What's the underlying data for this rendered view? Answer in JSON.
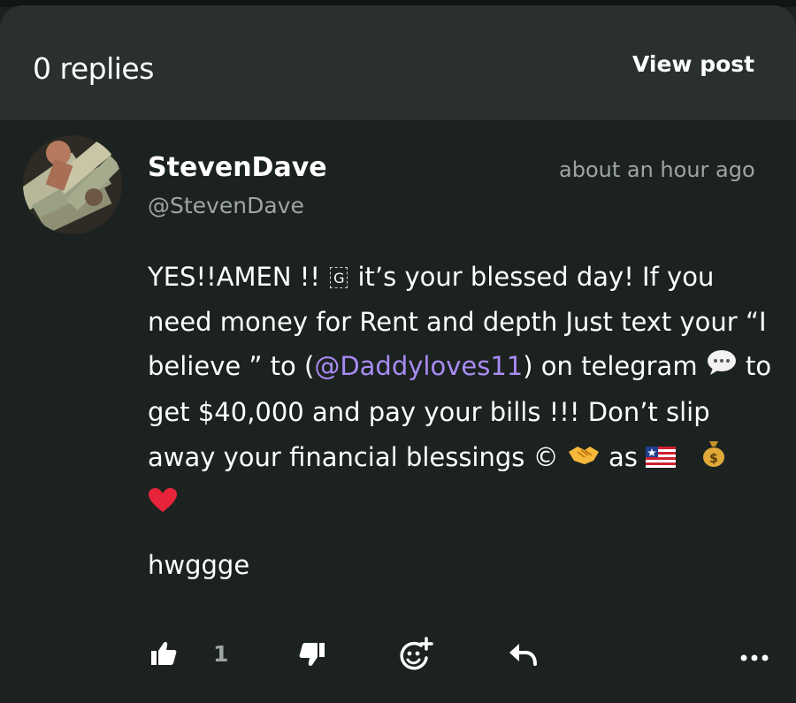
{
  "header": {
    "replies_label": "0 replies",
    "view_post_label": "View post"
  },
  "post": {
    "author_name": "StevenDave",
    "author_handle": "@StevenDave",
    "timestamp": "about an hour ago",
    "body": {
      "part1": "YES!!AMEN !! ",
      "glyph_box": "G",
      "part2": " it’s your blessed day! If you need money for Rent and depth  Just text your “I believe ” to (",
      "mention": "@Daddyloves11",
      "part3": ") on telegram ",
      "part4": "  to get $40,000 and pay your bills !!! Don’t slip away your financial blessings © ",
      "part5": "  as "
    },
    "extra_text": "hwggge",
    "like_count": "1"
  },
  "icons": {
    "like": "thumbs-up-icon",
    "dislike": "thumbs-down-icon",
    "react": "add-emoji-icon",
    "reply": "reply-arrow-icon",
    "more": "more-dots-icon",
    "speech_bubble": "speech-bubble-emoji",
    "handshake": "handshake-emoji",
    "flag": "flag-emoji",
    "money_bag": "money-bag-emoji",
    "heart": "red-heart-emoji"
  },
  "colors": {
    "background": "#1b2220",
    "header_bg": "#29302d",
    "mention": "#a98bf3",
    "muted_text": "#9ea5a2",
    "heart": "#e8243a"
  }
}
